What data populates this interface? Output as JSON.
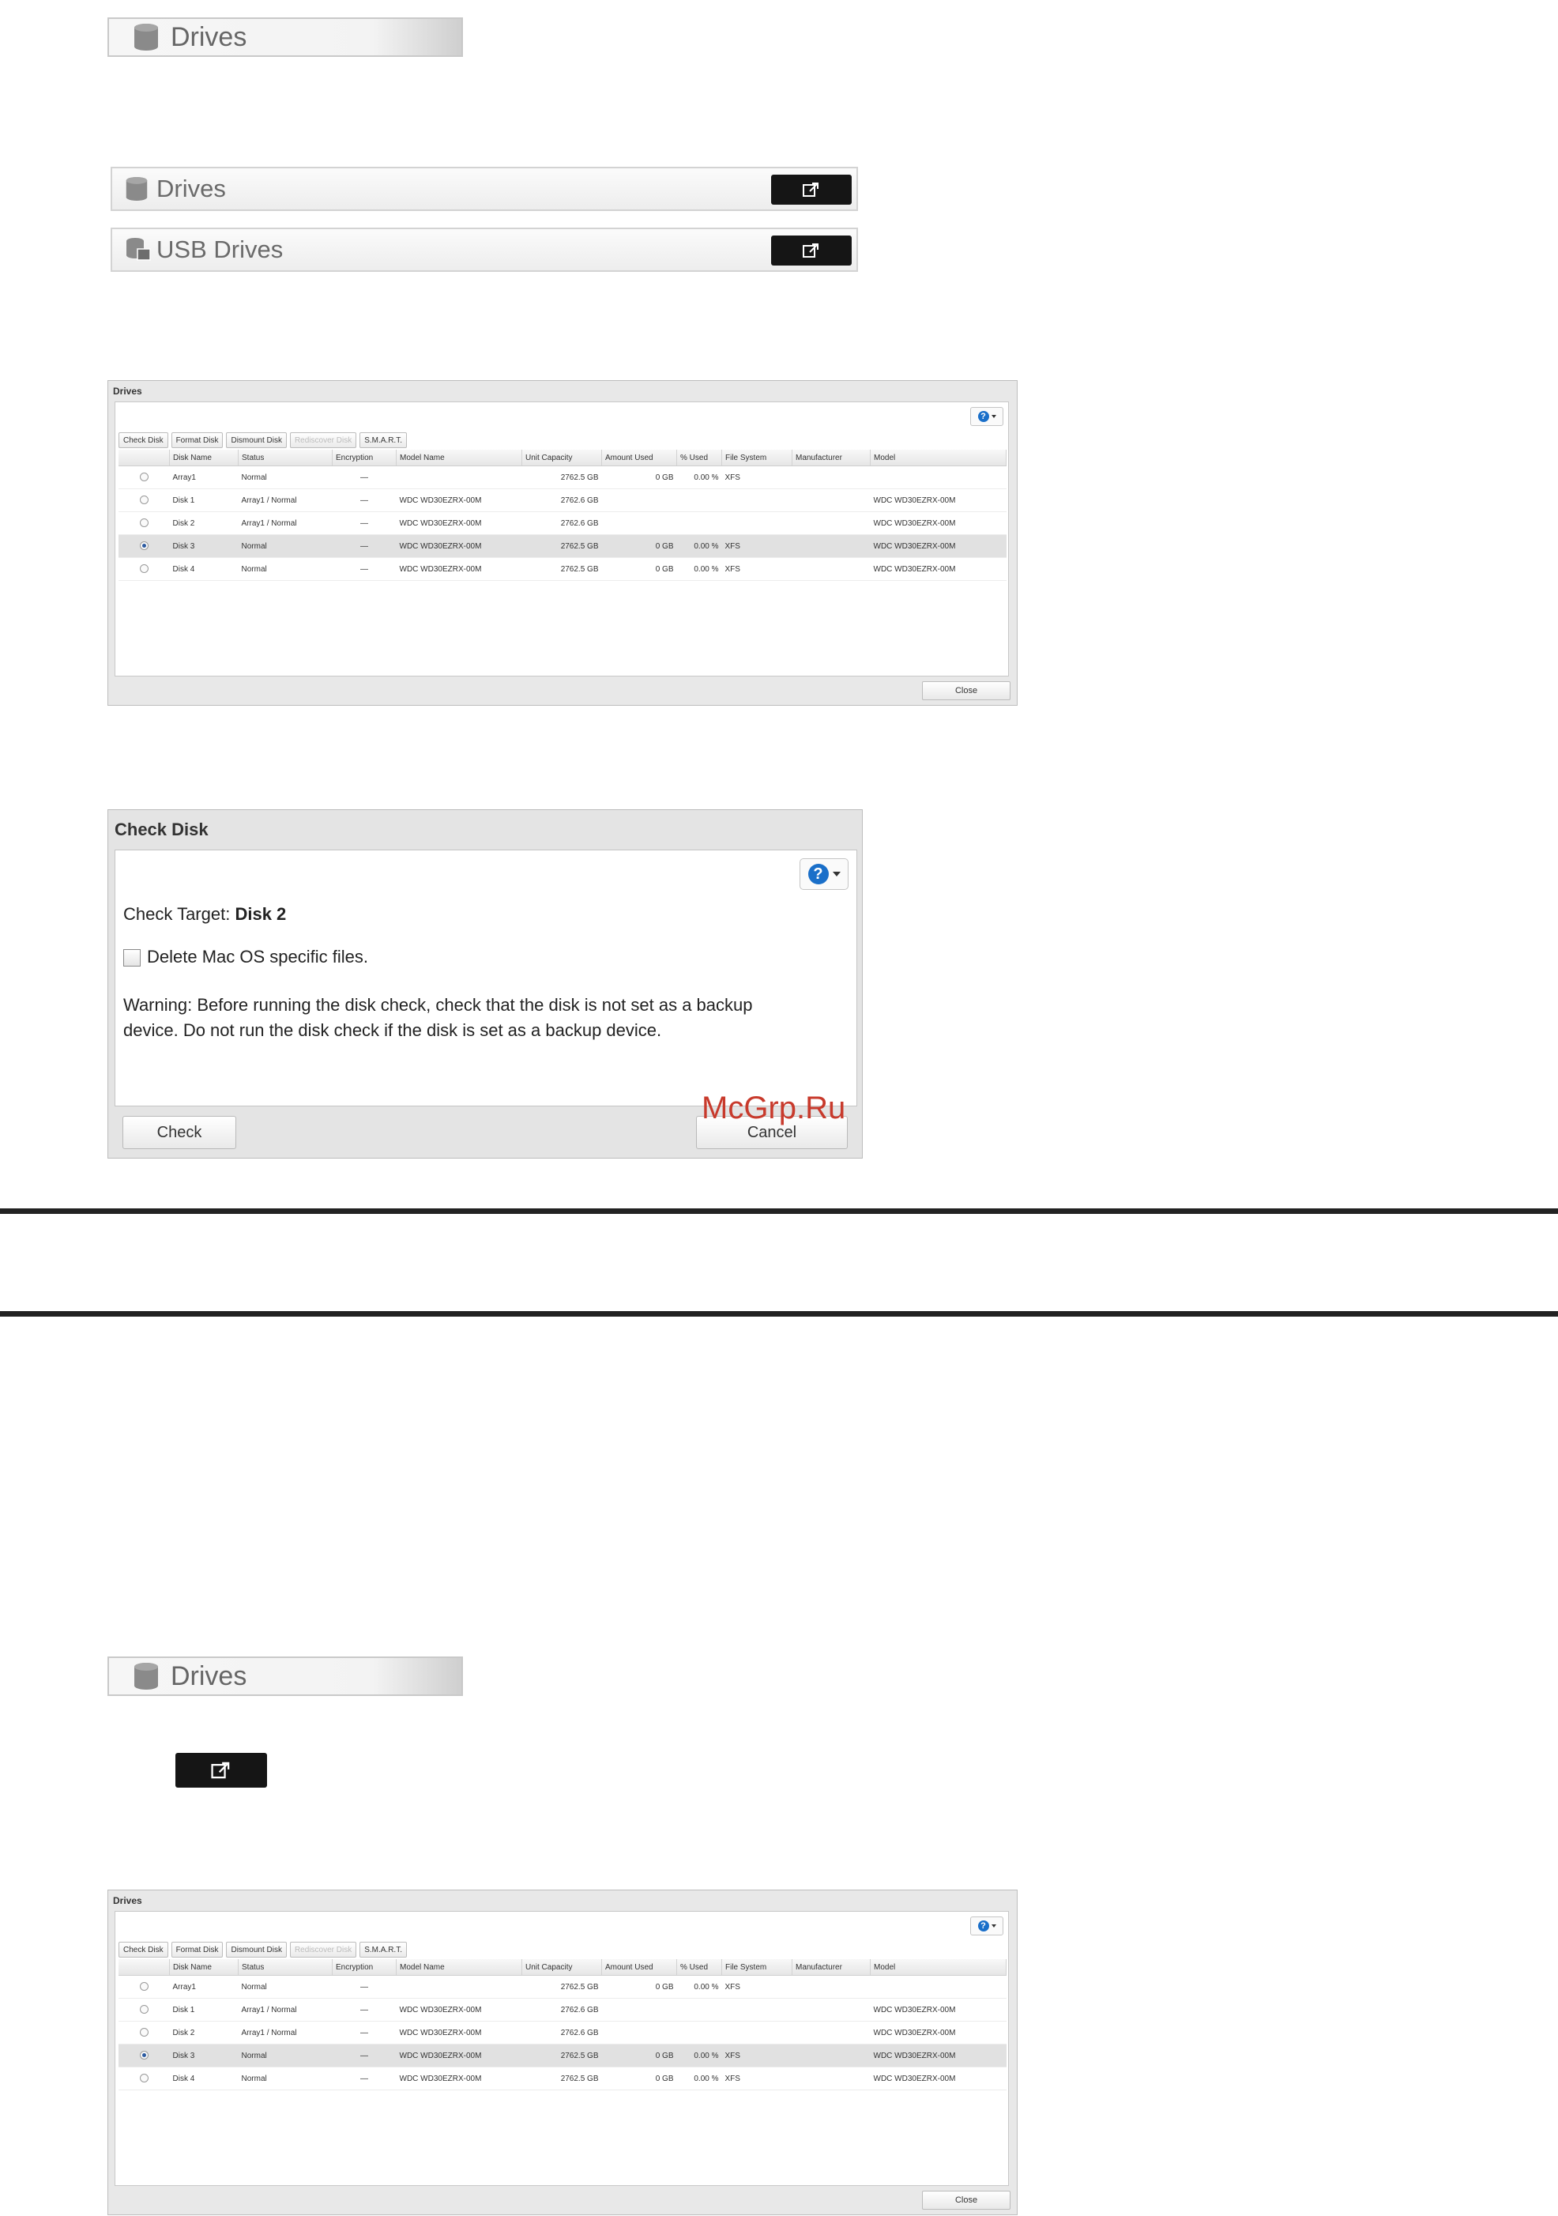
{
  "menu": {
    "drives_label": "Drives",
    "usb_drives_label": "USB Drives"
  },
  "drives_window": {
    "title": "Drives",
    "toolbar": [
      "Check Disk",
      "Format Disk",
      "Dismount Disk",
      "Rediscover Disk",
      "S.M.A.R.T."
    ],
    "columns": [
      "Disk Name",
      "Status",
      "Encryption",
      "Model Name",
      "Unit Capacity",
      "Amount Used",
      "% Used",
      "File System",
      "Manufacturer",
      "Model"
    ],
    "rows": [
      {
        "name": "Array1",
        "status": "Normal",
        "enc": "—",
        "model_name": "",
        "capacity": "2762.5 GB",
        "used": "0 GB",
        "pct": "0.00 %",
        "fs": "XFS",
        "mfr": "",
        "model": "",
        "selected": false
      },
      {
        "name": "Disk 1",
        "status": "Array1 / Normal",
        "enc": "—",
        "model_name": "WDC WD30EZRX-00M",
        "capacity": "2762.6 GB",
        "used": "",
        "pct": "",
        "fs": "",
        "mfr": "",
        "model": "WDC WD30EZRX-00M",
        "selected": false
      },
      {
        "name": "Disk 2",
        "status": "Array1 / Normal",
        "enc": "—",
        "model_name": "WDC WD30EZRX-00M",
        "capacity": "2762.6 GB",
        "used": "",
        "pct": "",
        "fs": "",
        "mfr": "",
        "model": "WDC WD30EZRX-00M",
        "selected": false
      },
      {
        "name": "Disk 3",
        "status": "Normal",
        "enc": "—",
        "model_name": "WDC WD30EZRX-00M",
        "capacity": "2762.5 GB",
        "used": "0 GB",
        "pct": "0.00 %",
        "fs": "XFS",
        "mfr": "",
        "model": "WDC WD30EZRX-00M",
        "selected": true
      },
      {
        "name": "Disk 4",
        "status": "Normal",
        "enc": "—",
        "model_name": "WDC WD30EZRX-00M",
        "capacity": "2762.5 GB",
        "used": "0 GB",
        "pct": "0.00 %",
        "fs": "XFS",
        "mfr": "",
        "model": "WDC WD30EZRX-00M",
        "selected": false
      }
    ],
    "close_label": "Close"
  },
  "check_disk": {
    "title": "Check Disk",
    "target_label": "Check Target:",
    "target_value": "Disk 2",
    "checkbox_label": "Delete Mac OS specific files.",
    "warning_line1": "Warning: Before running the disk check, check that the disk is not set as a backup",
    "warning_line2": "device. Do not run the disk check if the disk is set as a backup device.",
    "check_label": "Check",
    "cancel_label": "Cancel"
  },
  "watermark": "McGrp.Ru",
  "colors": {
    "help_blue": "#1a6fc9",
    "open_button": "#151515",
    "watermark_red": "#c83a2c"
  }
}
